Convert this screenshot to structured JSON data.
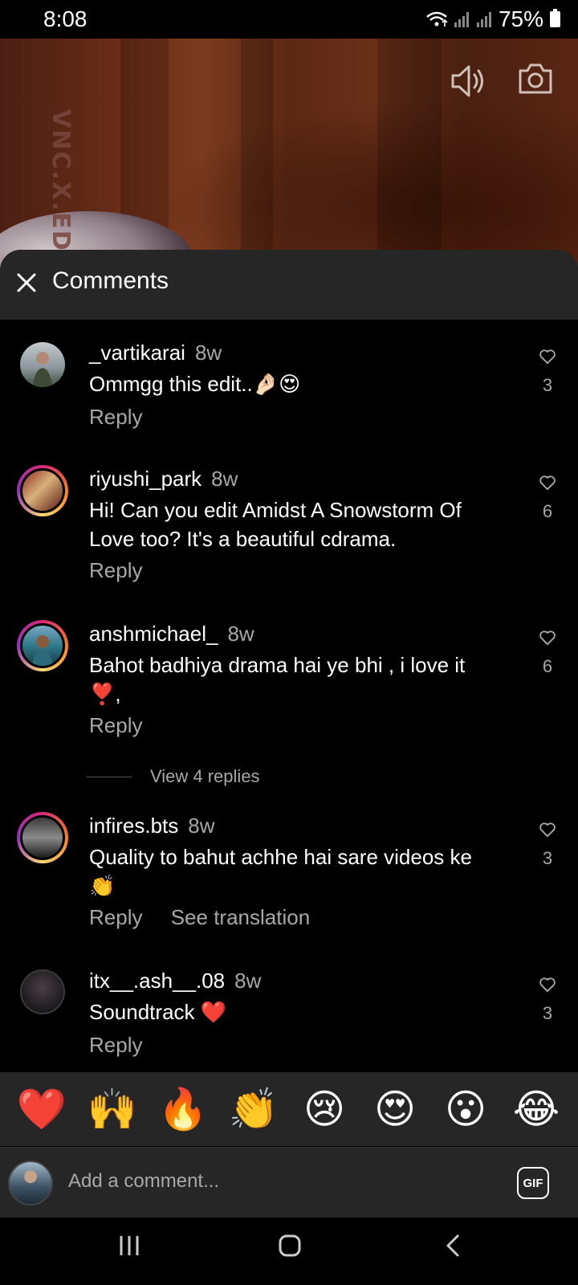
{
  "status": {
    "time": "8:08",
    "battery": "75%"
  },
  "video": {
    "watermark": "VNC.X.EDIT"
  },
  "sheet": {
    "title": "Comments"
  },
  "comments": [
    {
      "user": "_vartikarai",
      "time": "8w",
      "text": "Ommgg this edit..🤌🏻😍",
      "likes": "3",
      "actions": [
        "Reply"
      ]
    },
    {
      "user": "riyushi_park",
      "time": "8w",
      "text": "Hi! Can you edit Amidst A Snowstorm Of Love too? It's a beautiful cdrama.",
      "likes": "6",
      "actions": [
        "Reply"
      ]
    },
    {
      "user": "anshmichael_",
      "time": "8w",
      "text": "Bahot badhiya drama hai ye bhi , i love it ❣️,",
      "likes": "6",
      "actions": [
        "Reply"
      ]
    },
    {
      "user": "infires.bts",
      "time": "8w",
      "text": "Quality to bahut achhe hai sare videos ke👏",
      "likes": "3",
      "actions": [
        "Reply",
        "See translation"
      ]
    },
    {
      "user": "itx__.ash__.08",
      "time": "8w",
      "text": "Soundtrack ❤️",
      "likes": "3",
      "actions": [
        "Reply"
      ]
    }
  ],
  "view_replies": "View 4 replies",
  "emoji_bar": [
    "❤️",
    "🙌",
    "🔥",
    "👏",
    "😢",
    "😍",
    "😮",
    "😂"
  ],
  "input": {
    "placeholder": "Add a comment...",
    "gif_label": "GIF"
  },
  "icons": {
    "wifi": "wifi-icon",
    "signal": "signal-icon",
    "battery": "battery-icon",
    "volume": "volume-icon",
    "camera": "camera-icon",
    "close": "close-icon",
    "heart": "heart-outline-icon",
    "nav_recent": "recent-apps-icon",
    "nav_home": "home-icon",
    "nav_back": "back-icon"
  },
  "colors": {
    "sheet_bg": "#262626",
    "muted_text": "#a8a8a8",
    "background": "#000000"
  }
}
